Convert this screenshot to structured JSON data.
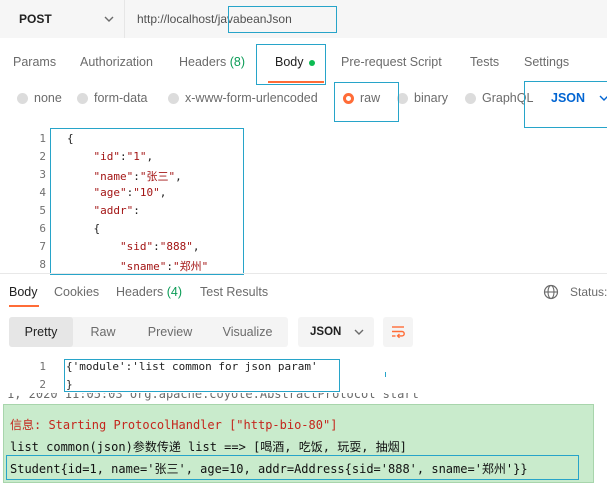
{
  "request": {
    "method": "POST",
    "url": "http://localhost/javabeanJson"
  },
  "request_tabs": {
    "params": "Params",
    "authorization": "Authorization",
    "headers": "Headers",
    "headers_count": "(8)",
    "body": "Body",
    "prerequest": "Pre-request Script",
    "tests": "Tests",
    "settings": "Settings"
  },
  "body_types": {
    "none": "none",
    "form_data": "form-data",
    "urlencoded": "x-www-form-urlencoded",
    "raw": "raw",
    "binary": "binary",
    "graphql": "GraphQL",
    "selected": "raw",
    "language": "JSON"
  },
  "editor": {
    "lines": [
      {
        "n": "1",
        "text": "{"
      },
      {
        "n": "2",
        "text": "    \"id\":\"1\","
      },
      {
        "n": "3",
        "text": "    \"name\":\"张三\","
      },
      {
        "n": "4",
        "text": "    \"age\":\"10\","
      },
      {
        "n": "5",
        "text": "    \"addr\":"
      },
      {
        "n": "6",
        "text": "    {"
      },
      {
        "n": "7",
        "text": "        \"sid\":\"888\","
      },
      {
        "n": "8",
        "text": "        \"sname\":\"郑州\""
      }
    ]
  },
  "response_tabs": {
    "body": "Body",
    "cookies": "Cookies",
    "headers": "Headers",
    "headers_count": "(4)",
    "test_results": "Test Results",
    "status": "Status:"
  },
  "response_view": {
    "pretty": "Pretty",
    "raw": "Raw",
    "preview": "Preview",
    "visualize": "Visualize",
    "language": "JSON"
  },
  "response_body": {
    "lines": [
      {
        "n": "1",
        "text": "{'module':'list common for json param'"
      },
      {
        "n": "2",
        "text": "}"
      }
    ]
  },
  "console": {
    "partial_top": "1, 2020 11:05:03 org.apache.coyote.AbstractProtocol start",
    "line1": "信息: Starting ProtocolHandler [\"http-bio-80\"]",
    "line2": "list common(json)参数传递 list ==> [喝酒, 吃饭, 玩耍, 抽烟]",
    "line3": "Student{id=1, name='张三', age=10, addr=Address{sid='888', sname='郑州'}}"
  },
  "colors": {
    "accent": "#ff6c37",
    "highlight_box": "#27a4c9",
    "link_blue": "#0265d2",
    "count_green": "#0c9c57",
    "console_bg": "#c9ebcc",
    "console_red": "#c4261d"
  }
}
